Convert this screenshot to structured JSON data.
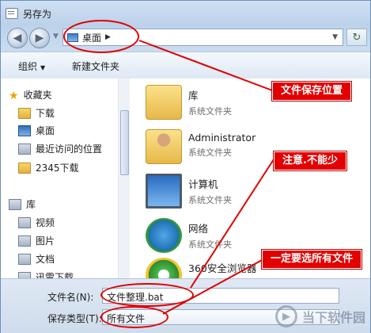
{
  "window": {
    "title": "另存为"
  },
  "address": {
    "location": "桌面",
    "search_placeholder": ""
  },
  "toolbar": {
    "organize_label": "组织",
    "new_folder_label": "新建文件夹"
  },
  "nav_pane": {
    "favorites_header": "收藏夹",
    "favorites": [
      "下载",
      "桌面",
      "最近访问的位置",
      "2345下载"
    ],
    "libraries_header": "库",
    "libraries": [
      "视频",
      "图片",
      "文档",
      "迅雷下载"
    ]
  },
  "files": [
    {
      "name": "库",
      "sub": "系统文件夹",
      "icon": "library-folder-icon"
    },
    {
      "name": "Administrator",
      "sub": "系统文件夹",
      "icon": "user-folder-icon"
    },
    {
      "name": "计算机",
      "sub": "系统文件夹",
      "icon": "computer-icon"
    },
    {
      "name": "网络",
      "sub": "系统文件夹",
      "icon": "network-icon"
    },
    {
      "name": "360安全浏览器",
      "sub": "",
      "icon": "browser-icon"
    }
  ],
  "bottom": {
    "filename_label": "文件名(N):",
    "filename_value": "文件整理.bat",
    "filetype_label": "保存类型(T):",
    "filetype_value": "所有文件"
  },
  "annotations": {
    "save_location": "文件保存位置",
    "note": "注意.不能少",
    "all_files": "一定要选所有文件"
  },
  "watermark": {
    "text": "当下软件园"
  },
  "colors": {
    "annotation_red": "#e30000",
    "accent": "#3b79c4"
  }
}
